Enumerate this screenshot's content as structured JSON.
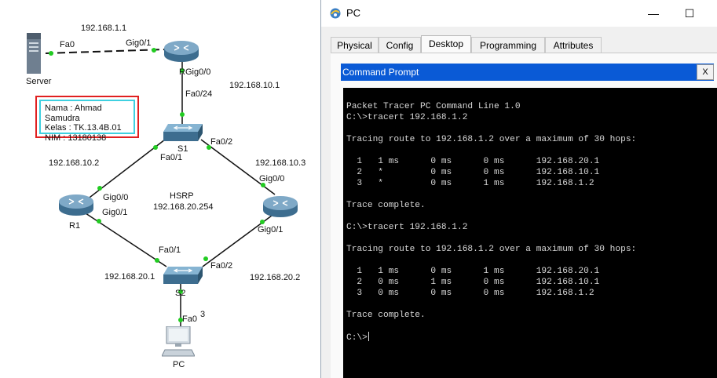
{
  "topology": {
    "note": {
      "name": "Nama : Ahmad Samudra",
      "kelas": "Kelas : TK.13.4B.01",
      "nim": "NIM : 13180138"
    },
    "devices": {
      "server": "Server",
      "router_r": "R",
      "r1": "R1",
      "s1": "S1",
      "s2": "S2",
      "pc": "PC"
    },
    "ips": {
      "server_link": "192.168.1.1",
      "r_down": "192.168.10.1",
      "r1_up": "192.168.10.2",
      "r2_up": "192.168.10.3",
      "hsrp_title": "HSRP",
      "hsrp_ip": "192.168.20.254",
      "r1_down": "192.168.20.1",
      "r2_down": "192.168.20.2"
    },
    "ports": {
      "server_fa0": "Fa0",
      "r_gig01": "Gig0/1",
      "r_gig00": "Gig0/0",
      "s1_fa024": "Fa0/24",
      "s1_fa01": "Fa0/1",
      "s1_fa02": "Fa0/2",
      "r1_gig00": "Gig0/0",
      "r1_gig01": "Gig0/1",
      "r2_gig00": "Gig0/0",
      "r2_gig01": "Gig0/1",
      "s2_fa01": "Fa0/1",
      "s2_fa02": "Fa0/2",
      "s2_fa03_tail": "3",
      "pc_fa0": "Fa0"
    }
  },
  "window": {
    "title": "PC",
    "controls": {
      "minimize": "—",
      "maximize": "☐"
    },
    "tabs": [
      "Physical",
      "Config",
      "Desktop",
      "Programming",
      "Attributes"
    ],
    "active_tab": "Desktop",
    "cmd_title": "Command Prompt",
    "cmd_close": "X",
    "console_lines": [
      "Packet Tracer PC Command Line 1.0",
      "C:\\>tracert 192.168.1.2",
      "",
      "Tracing route to 192.168.1.2 over a maximum of 30 hops:",
      "",
      "  1   1 ms      0 ms      0 ms      192.168.20.1",
      "  2   *         0 ms      0 ms      192.168.10.1",
      "  3   *         0 ms      1 ms      192.168.1.2",
      "",
      "Trace complete.",
      "",
      "C:\\>tracert 192.168.1.2",
      "",
      "Tracing route to 192.168.1.2 over a maximum of 30 hops:",
      "",
      "  1   1 ms      0 ms      1 ms      192.168.20.1",
      "  2   0 ms      1 ms      0 ms      192.168.10.1",
      "  3   0 ms      0 ms      0 ms      192.168.1.2",
      "",
      "Trace complete.",
      "",
      "C:\\>"
    ]
  },
  "colors": {
    "link_up": "#22cc22",
    "cmd_bar": "#0a5ad6",
    "note_border": "#e02020",
    "note_inner": "#3fd0e0"
  }
}
